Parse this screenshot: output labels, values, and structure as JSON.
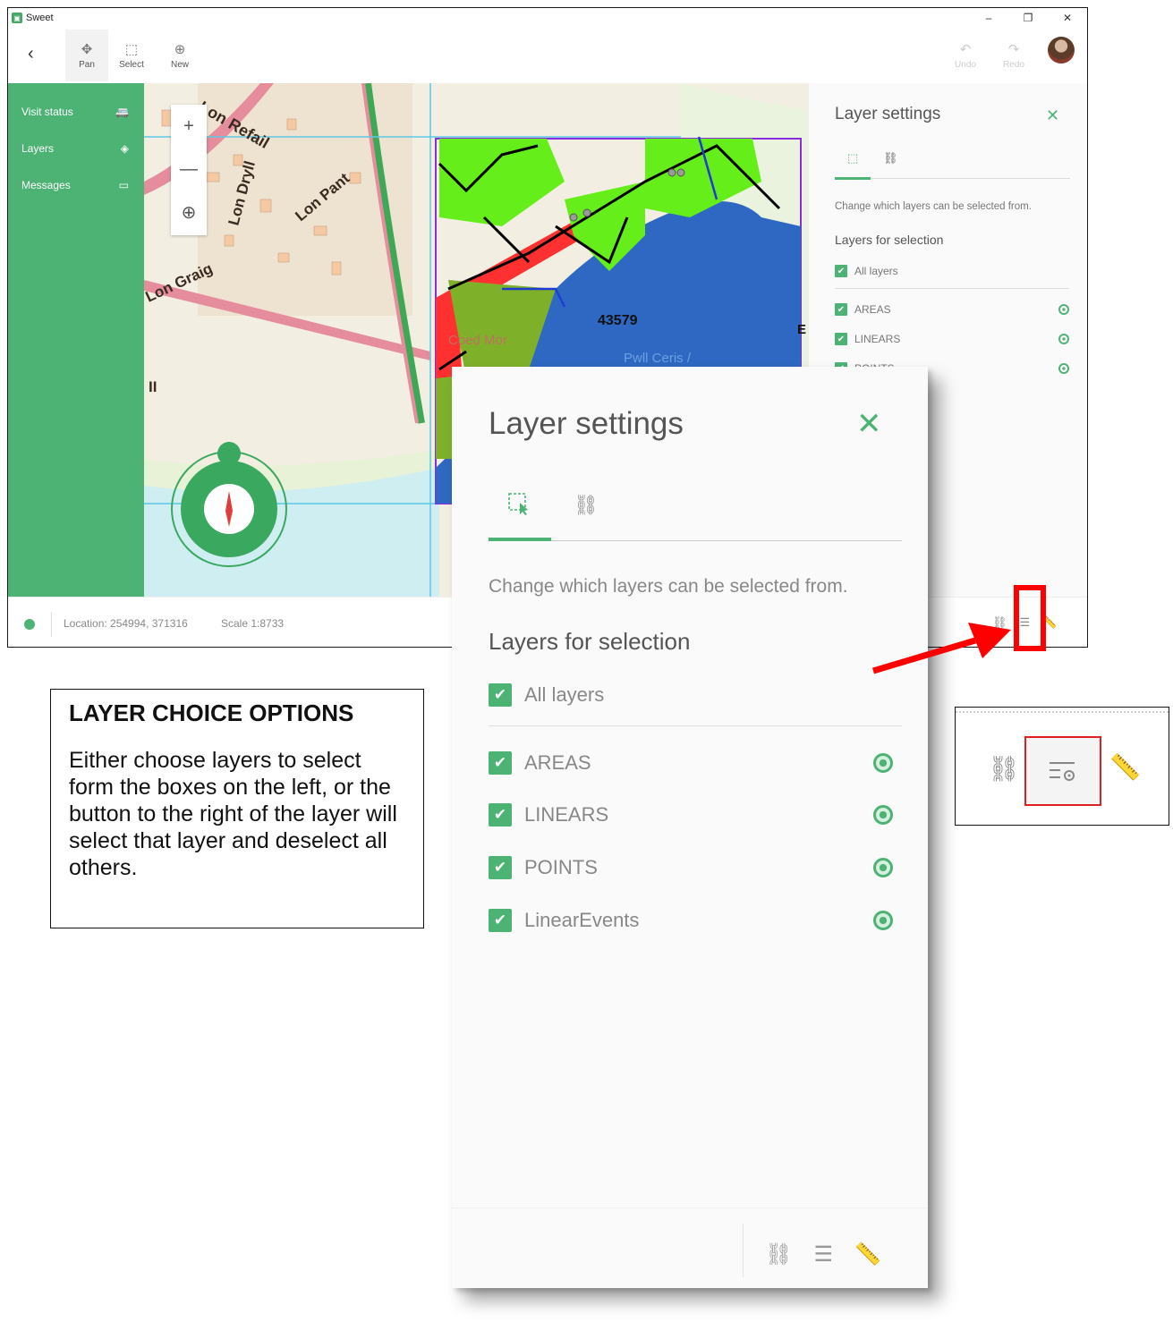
{
  "window": {
    "app_title": "Sweet",
    "controls": [
      "–",
      "❐",
      "✕"
    ]
  },
  "toolbar": {
    "back_label": "‹",
    "tools": [
      {
        "label": "Pan",
        "icon": "pan-icon"
      },
      {
        "label": "Select",
        "icon": "select-icon"
      },
      {
        "label": "New",
        "icon": "add-icon"
      }
    ],
    "undo_label": "Undo",
    "redo_label": "Redo"
  },
  "sidebar": {
    "items": [
      {
        "label": "Visit status",
        "icon": "van-icon"
      },
      {
        "label": "Layers",
        "icon": "layers-icon"
      },
      {
        "label": "Messages",
        "icon": "message-icon"
      }
    ]
  },
  "map": {
    "zoom_in": "+",
    "zoom_out": "—",
    "locate": "⊕",
    "labels": {
      "street1": "Lon Refail",
      "street2": "Lon Dryll",
      "street3": "Lon Pant",
      "street4": "Lon Graig",
      "parcel": "43579",
      "place1": "Coed Mor",
      "place2": "Pwll Ceris /",
      "edge_e": "E",
      "edge_ii": "II"
    }
  },
  "layer_panel": {
    "title": "Layer settings",
    "close": "✕",
    "description": "Change which layers can be selected from.",
    "section_heading": "Layers for selection",
    "all_layers_label": "All layers",
    "layers": [
      {
        "label": "AREAS",
        "checked": true
      },
      {
        "label": "LINEARS",
        "checked": true
      },
      {
        "label": "POINTS",
        "checked": true
      },
      {
        "label": "LinearEvents",
        "checked": true
      }
    ],
    "small_visible_layers": [
      {
        "label": "AREAS"
      },
      {
        "label": "LINEARS"
      },
      {
        "label": "POINTS"
      }
    ],
    "checkmark": "✔",
    "accent_color": "#4db375"
  },
  "statusbar": {
    "location": "Location: 254994, 371316",
    "scale": "Scale 1:8733"
  },
  "callout": {
    "title": "LAYER CHOICE OPTIONS",
    "body": "Either choose layers to select form the boxes on the left, or the button to the right of the layer will select that layer and deselect all others."
  },
  "annotation": {
    "highlight_color": "#ff0000"
  }
}
